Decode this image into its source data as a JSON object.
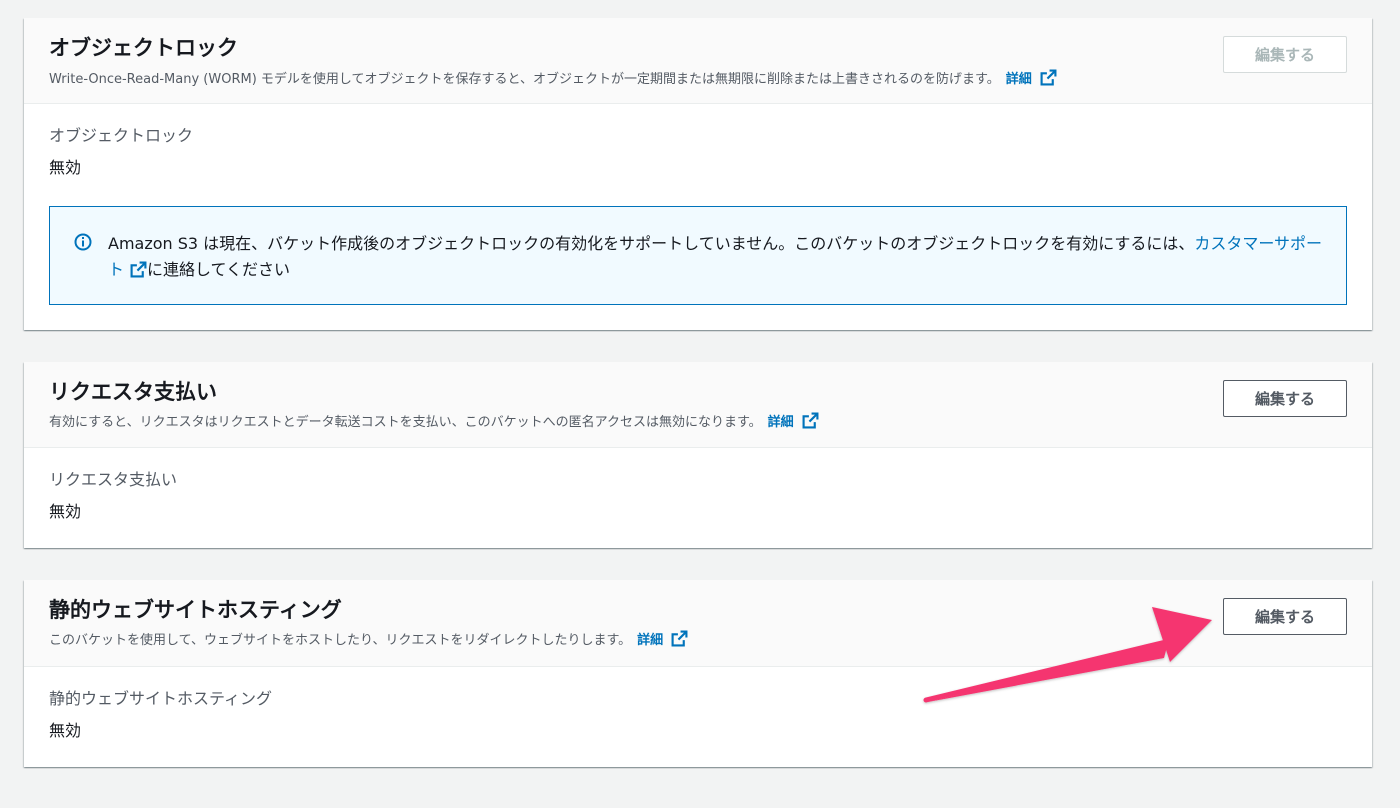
{
  "panels": {
    "object_lock": {
      "title": "オブジェクトロック",
      "description": "Write-Once-Read-Many (WORM) モデルを使用してオブジェクトを保存すると、オブジェクトが一定期間または無期限に削除または上書きされるのを防げます。",
      "info_link": "詳細",
      "edit_label": "編集する",
      "edit_disabled": true,
      "field_label": "オブジェクトロック",
      "field_value": "無効",
      "alert": {
        "text_before": "Amazon S3 は現在、バケット作成後のオブジェクトロックの有効化をサポートしていません。このバケットのオブジェクトロックを有効にするには、",
        "link_text": "カスタマーサポート",
        "text_after": "に連絡してください"
      }
    },
    "requester_pays": {
      "title": "リクエスタ支払い",
      "description": "有効にすると、リクエスタはリクエストとデータ転送コストを支払い、このバケットへの匿名アクセスは無効になります。",
      "info_link": "詳細",
      "edit_label": "編集する",
      "field_label": "リクエスタ支払い",
      "field_value": "無効"
    },
    "static_website": {
      "title": "静的ウェブサイトホスティング",
      "description": "このバケットを使用して、ウェブサイトをホストしたり、リクエストをリダイレクトしたりします。",
      "info_link": "詳細",
      "edit_label": "編集する",
      "field_label": "静的ウェブサイトホスティング",
      "field_value": "無効"
    }
  },
  "colors": {
    "link": "#0073bb",
    "annotation_arrow": "#f5356f",
    "alert_bg": "#f1faff"
  }
}
